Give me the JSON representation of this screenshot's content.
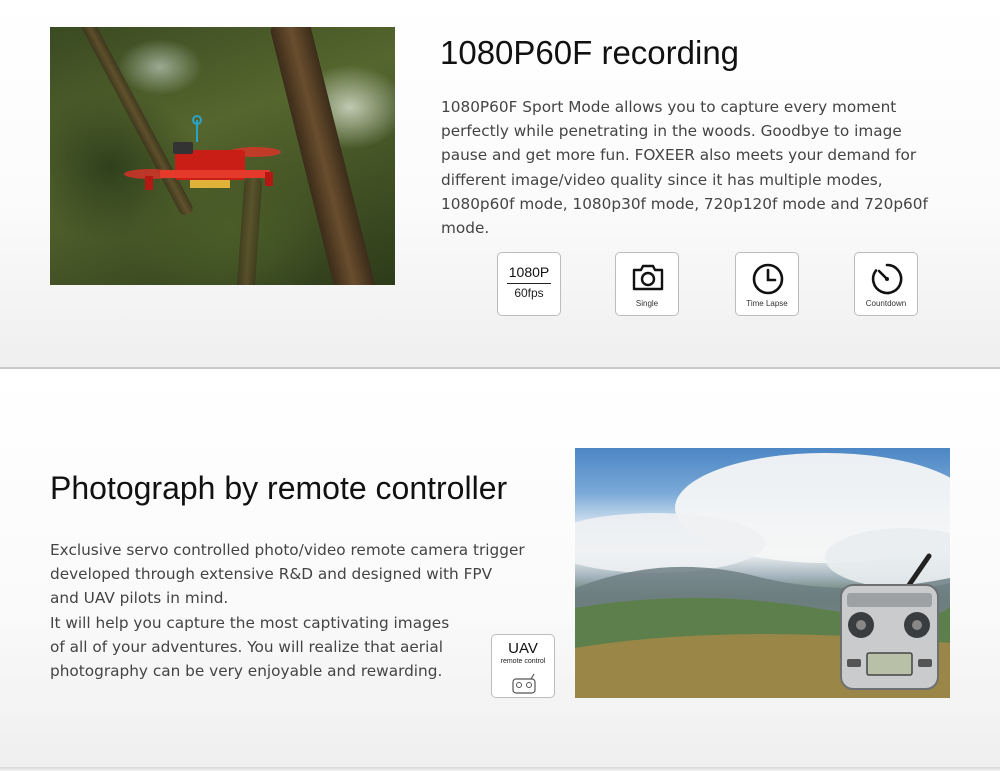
{
  "section1": {
    "heading": "1080P60F recording",
    "paragraph_lines": [
      "1080P60F Sport Mode allows you to capture every moment",
      "perfectly while penetrating in the woods.  Goodbye to image",
      "pause and get more fun. FOXEER also meets your demand for",
      "different image/video quality since it has multiple modes,",
      "1080p60f mode, 1080p30f mode, 720p120f mode and 720p60f",
      "mode."
    ],
    "badges": {
      "resolution_top": "1080P",
      "resolution_bottom": "60fps",
      "single": "Single",
      "time_lapse": "Time Lapse",
      "countdown": "Countdown"
    }
  },
  "section2": {
    "heading": "Photograph by remote controller",
    "paragraph_lines": [
      "Exclusive servo controlled photo/video remote camera trigger",
      "developed through extensive R&D and designed with FPV",
      "and UAV pilots in mind.",
      "It will help you capture the most captivating images",
      "of all of your adventures. You will realize that aerial",
      "photography can be very enjoyable and rewarding."
    ],
    "badge": {
      "title": "UAV",
      "subtitle": "remote control"
    }
  },
  "icons": [
    "camera-icon",
    "clock-icon",
    "countdown-timer-icon",
    "remote-controller-icon"
  ],
  "colors": {
    "drone_red": "#d8261c",
    "text": "#444444",
    "heading": "#111111"
  }
}
